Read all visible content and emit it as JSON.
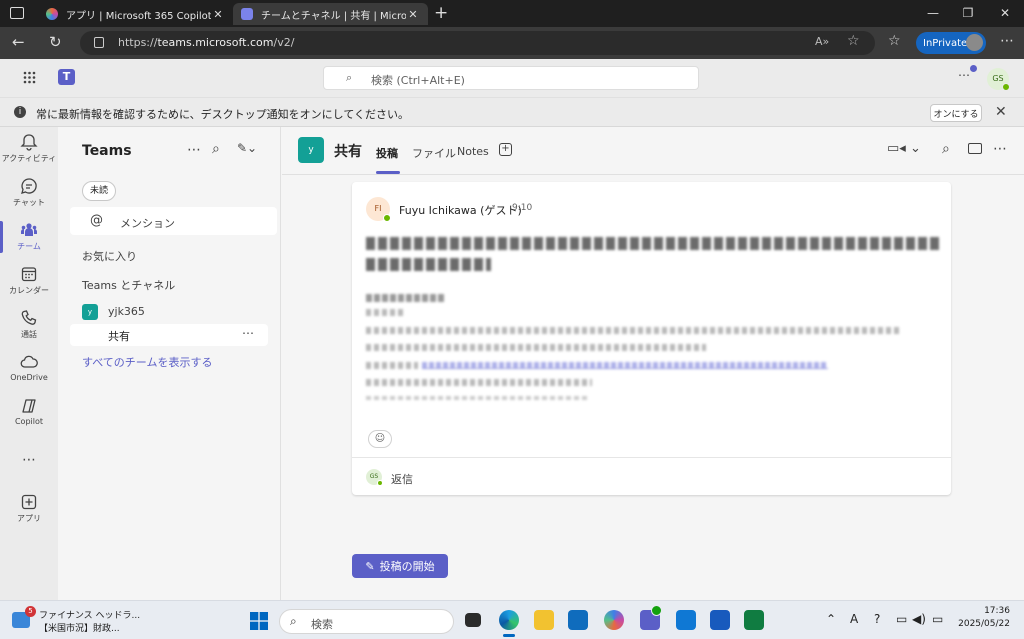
{
  "browser": {
    "tabs": [
      {
        "title": "アプリ | Microsoft 365 Copilot",
        "active": false
      },
      {
        "title": "チームとチャネル | 共有 | Microsoft Te",
        "active": true
      }
    ],
    "url_prefix": "https://",
    "url_host": "teams.microsoft.com",
    "url_path": "/v2/",
    "inprivate_label": "InPrivate"
  },
  "teams_header": {
    "search_placeholder": "検索 (Ctrl+Alt+E)",
    "user_initials": "GS"
  },
  "notification": {
    "text": "常に最新情報を確認するために、デスクトップ通知をオンにしてください。",
    "button": "オンにする"
  },
  "rail": [
    {
      "label": "アクティビティ",
      "icon": "bell-icon"
    },
    {
      "label": "チャット",
      "icon": "chat-icon"
    },
    {
      "label": "チーム",
      "icon": "teams-icon",
      "active": true
    },
    {
      "label": "カレンダー",
      "icon": "calendar-icon"
    },
    {
      "label": "通話",
      "icon": "phone-icon"
    },
    {
      "label": "OneDrive",
      "icon": "cloud-icon"
    },
    {
      "label": "Copilot",
      "icon": "copilot-icon"
    },
    {
      "label": "アプリ",
      "icon": "add-app-icon"
    }
  ],
  "sidepanel": {
    "title": "Teams",
    "filter_chip": "未読",
    "mentions": "メンション",
    "favorites": "お気に入り",
    "section": "Teams とチャネル",
    "team_avatar": "y",
    "team_name": "yjk365",
    "channel_name": "共有",
    "show_all": "すべてのチームを表示する"
  },
  "channel": {
    "avatar_letter": "y",
    "name": "共有",
    "tabs": [
      "投稿",
      "ファイル",
      "Notes"
    ]
  },
  "post": {
    "author_initials": "FI",
    "author": "Fuyu Ichikawa (ゲスト)",
    "time": "9:10",
    "reply_initials": "GS",
    "reply_label": "返信"
  },
  "new_post_button": "投稿の開始",
  "taskbar": {
    "news_badge": "5",
    "news_title": "ファイナンス ヘッドラ...",
    "news_sub": "【米国市況】財政...",
    "search_placeholder": "検索",
    "time": "17:36",
    "date": "2025/05/22"
  },
  "colors": {
    "brand": "#5b5fc7",
    "team_tile": "#13a096",
    "inprivate": "#1565c0"
  }
}
